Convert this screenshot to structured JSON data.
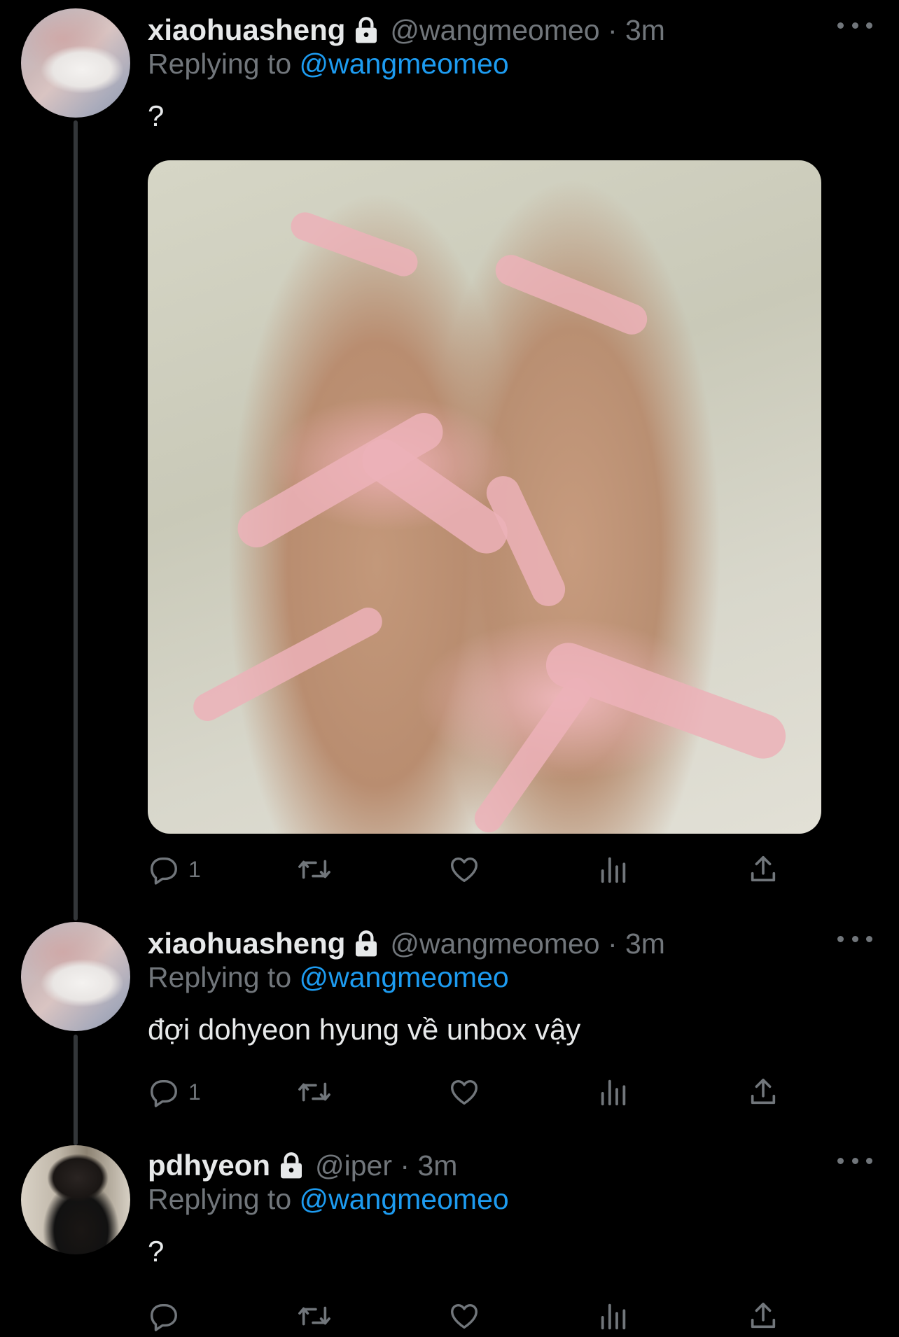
{
  "tweets": [
    {
      "name": "xiaohuasheng",
      "handle": "@wangmeomeo",
      "time": "3m",
      "replying_prefix": "Replying to ",
      "replying_to": "@wangmeomeo",
      "text": "?",
      "has_media": true,
      "reply_count": "1",
      "avatar_icon": "avatar-photo"
    },
    {
      "name": "xiaohuasheng",
      "handle": "@wangmeomeo",
      "time": "3m",
      "replying_prefix": "Replying to ",
      "replying_to": "@wangmeomeo",
      "text": "đợi dohyeon hyung về unbox vậy",
      "has_media": false,
      "reply_count": "1",
      "avatar_icon": "avatar-photo"
    },
    {
      "name": "pdhyeon",
      "handle": "@iper",
      "time": "3m",
      "replying_prefix": "Replying to ",
      "replying_to": "@wangmeomeo",
      "text": "?",
      "has_media": false,
      "reply_count": "",
      "avatar_icon": "avatar-photo"
    }
  ],
  "separator": " · ",
  "icons": {
    "lock": "lock-icon",
    "more": "more-icon",
    "reply": "reply-icon",
    "retweet": "retweet-icon",
    "like": "like-icon",
    "views": "views-icon",
    "share": "share-icon"
  },
  "colors": {
    "background": "#000000",
    "primary_text": "#e7e9ea",
    "secondary_text": "#71767b",
    "link": "#1d9bf0",
    "thread_line": "#333639"
  }
}
